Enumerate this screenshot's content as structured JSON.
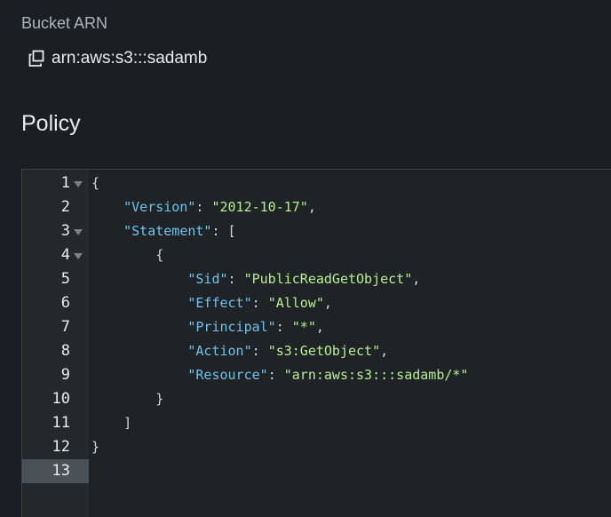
{
  "bucket_arn": {
    "label": "Bucket ARN",
    "value": "arn:aws:s3:::sadamb",
    "icon": "copy-icon"
  },
  "policy": {
    "title": "Policy",
    "line_numbers": [
      "1",
      "2",
      "3",
      "4",
      "5",
      "6",
      "7",
      "8",
      "9",
      "10",
      "11",
      "12",
      "13"
    ],
    "fold_lines": [
      "1",
      "3",
      "4"
    ],
    "active_line": "13",
    "lines": [
      "{",
      "    \"Version\": \"2012-10-17\",",
      "    \"Statement\": [",
      "        {",
      "            \"Sid\": \"PublicReadGetObject\",",
      "            \"Effect\": \"Allow\",",
      "            \"Principal\": \"*\",",
      "            \"Action\": \"s3:GetObject\",",
      "            \"Resource\": \"arn:aws:s3:::sadamb/*\"",
      "        }",
      "    ]",
      "}",
      ""
    ]
  },
  "colors": {
    "background": "#1b1e22",
    "editor_bg": "#1f2326",
    "gutter_bg": "#25282b",
    "active_line_bg": "#4b5257",
    "key": "#6fc3ec",
    "string": "#b6ee92"
  }
}
